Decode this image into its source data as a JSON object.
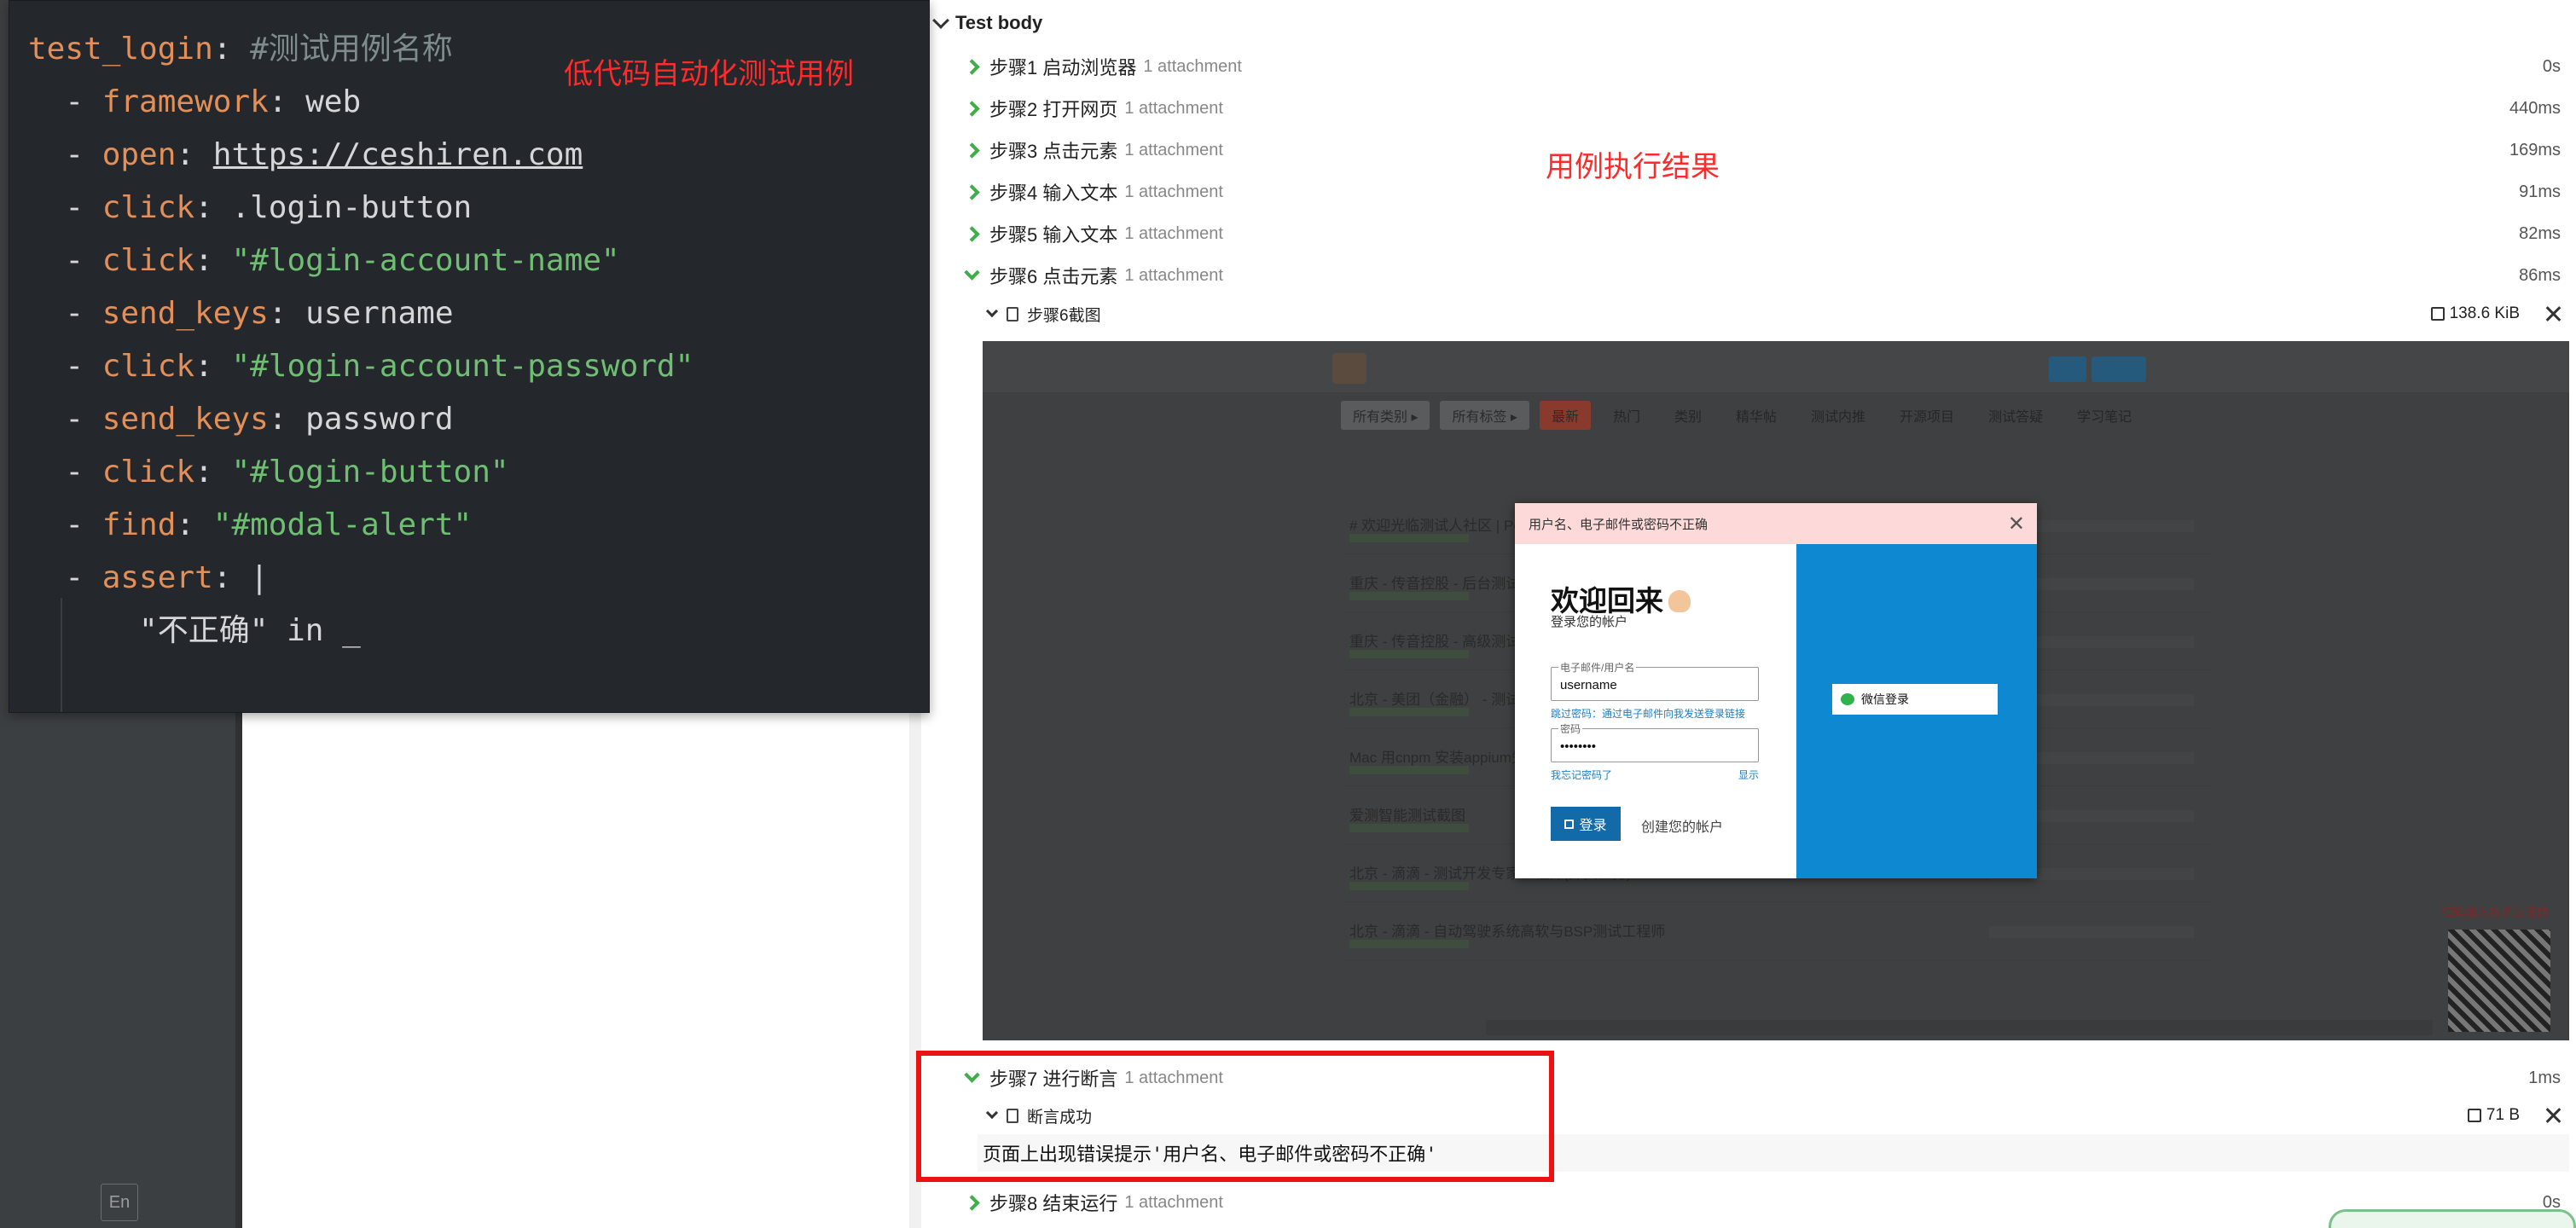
{
  "code": {
    "lines": [
      [
        {
          "t": "test_login",
          "c": "k-key"
        },
        {
          "t": ": ",
          "c": "k-plain"
        },
        {
          "t": "#测试用例名称",
          "c": "k-com"
        }
      ],
      [
        {
          "t": "  - ",
          "c": "k-plain"
        },
        {
          "t": "framework",
          "c": "k-key"
        },
        {
          "t": ": web",
          "c": "k-plain"
        }
      ],
      [
        {
          "t": "  - ",
          "c": "k-plain"
        },
        {
          "t": "open",
          "c": "k-key"
        },
        {
          "t": ": ",
          "c": "k-plain"
        },
        {
          "t": "https://ceshiren.com",
          "c": "k-link"
        }
      ],
      [
        {
          "t": "  - ",
          "c": "k-plain"
        },
        {
          "t": "click",
          "c": "k-key"
        },
        {
          "t": ": .login-button",
          "c": "k-plain"
        }
      ],
      [
        {
          "t": "  - ",
          "c": "k-plain"
        },
        {
          "t": "click",
          "c": "k-key"
        },
        {
          "t": ": ",
          "c": "k-plain"
        },
        {
          "t": "\"#login-account-name\"",
          "c": "k-str"
        }
      ],
      [
        {
          "t": "  - ",
          "c": "k-plain"
        },
        {
          "t": "send_keys",
          "c": "k-key"
        },
        {
          "t": ": username",
          "c": "k-plain"
        }
      ],
      [
        {
          "t": "  - ",
          "c": "k-plain"
        },
        {
          "t": "click",
          "c": "k-key"
        },
        {
          "t": ": ",
          "c": "k-plain"
        },
        {
          "t": "\"#login-account-password\"",
          "c": "k-str"
        }
      ],
      [
        {
          "t": "  - ",
          "c": "k-plain"
        },
        {
          "t": "send_keys",
          "c": "k-key"
        },
        {
          "t": ": password",
          "c": "k-plain"
        }
      ],
      [
        {
          "t": "  - ",
          "c": "k-plain"
        },
        {
          "t": "click",
          "c": "k-key"
        },
        {
          "t": ": ",
          "c": "k-plain"
        },
        {
          "t": "\"#login-button\"",
          "c": "k-str"
        }
      ],
      [
        {
          "t": "  - ",
          "c": "k-plain"
        },
        {
          "t": "find",
          "c": "k-key"
        },
        {
          "t": ": ",
          "c": "k-plain"
        },
        {
          "t": "\"#modal-alert\"",
          "c": "k-str"
        }
      ],
      [
        {
          "t": "  - ",
          "c": "k-plain"
        },
        {
          "t": "assert",
          "c": "k-key"
        },
        {
          "t": ": |",
          "c": "k-plain"
        }
      ],
      [
        {
          "t": "      \"不正确\" in _",
          "c": "k-plain"
        }
      ]
    ],
    "annotation": "低代码自动化测试用例"
  },
  "ide": {
    "lang_button": "En"
  },
  "report": {
    "section_title": "Test body",
    "result_annotation": "用例执行结果",
    "steps": [
      {
        "title": "步骤1 启动浏览器",
        "attach": "1 attachment",
        "duration": "0s",
        "expanded": false
      },
      {
        "title": "步骤2 打开网页",
        "attach": "1 attachment",
        "duration": "440ms",
        "expanded": false
      },
      {
        "title": "步骤3 点击元素",
        "attach": "1 attachment",
        "duration": "169ms",
        "expanded": false
      },
      {
        "title": "步骤4 输入文本",
        "attach": "1 attachment",
        "duration": "91ms",
        "expanded": false
      },
      {
        "title": "步骤5 输入文本",
        "attach": "1 attachment",
        "duration": "82ms",
        "expanded": false
      },
      {
        "title": "步骤6 点击元素",
        "attach": "1 attachment",
        "duration": "86ms",
        "expanded": true
      }
    ],
    "step6_attachment": {
      "name": "步骤6截图",
      "size": "138.6 KiB"
    },
    "step7": {
      "title": "步骤7 进行断言",
      "attach": "1 attachment",
      "duration": "1ms"
    },
    "step7_attachment": {
      "name": "断言成功",
      "size": "71 B"
    },
    "assert_text": "页面上出现错误提示'用户名、电子邮件或密码不正确'",
    "step8": {
      "title": "步骤8 结束运行",
      "attach": "1 attachment",
      "duration": "0s"
    }
  },
  "screenshot": {
    "tabs": [
      "所有类别 ▸",
      "所有标签 ▸",
      "最新",
      "热门",
      "类别",
      "精华帖",
      "测试内推",
      "开源项目",
      "测试答疑",
      "学习笔记"
    ],
    "rows": [
      "# 欢迎光临测试人社区 | Pe",
      "重庆 - 传音控股 - 后台测试",
      "重庆 - 传音控股 - 高级测试",
      "北京 - 美团（金融） - 测试",
      "Mac 用cnpm 安装appium失",
      "爱测智能测试截图",
      "北京 - 滴滴 - 测试开发专家工程师(外卖业务)",
      "北京 - 滴滴 - 自动驾驶系统高软与BSP测试工程师"
    ],
    "qr_caption": "扫码加入技术交流群",
    "modal": {
      "alert": "用户名、电子邮件或密码不正确",
      "close": "✕",
      "welcome": "欢迎回来",
      "subtitle": "登录您的帐户",
      "email_label": "电子邮件/用户名",
      "email_value": "username",
      "skip_password_link": "跳过密码：通过电子邮件向我发送登录链接",
      "password_label": "密码",
      "password_value": "••••••••",
      "forgot_link": "我忘记密码了",
      "show_link": "显示",
      "login_button": "登录",
      "create_account": "创建您的帐户",
      "wechat_button": "微信登录"
    }
  }
}
